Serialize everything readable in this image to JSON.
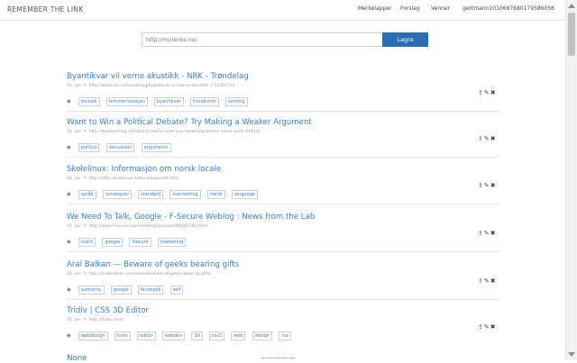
{
  "brand": "REMEMBER THE LINK",
  "nav": [
    "Merkelapper",
    "Forslag",
    "Venner",
    "gertmann1010697680179586056"
  ],
  "form": {
    "placeholder": "http://my.lenke.no/",
    "save_label": "Lagre"
  },
  "links": [
    {
      "title": "Byantikvar vil verne akustikk - NRK - Trøndelag",
      "date": "16. jan",
      "url": "http://www.nrk.no/trondelag/byantikvar-vil-verne-akustikk-1.11203733",
      "tags": [
        "musikk",
        "femmeriveskjen",
        "byantikvar",
        "trondheim",
        "verning"
      ]
    },
    {
      "title": "Want to Win a Political Debate? Try Making a Weaker Argument",
      "date": "16. jan",
      "url": "http://www.psmag.com/politics/why-even-your-best-arguments-never-work-64910/",
      "tags": [
        "politics",
        "discussion",
        "arguments"
      ]
    },
    {
      "title": "Skolelinux: Informasjon om norsk locale",
      "date": "16. jan",
      "url": "http://i18n.skolelinux.no/localeoppsett.html",
      "tags": [
        "språk",
        "norwegian",
        "standard",
        "oversetting",
        "norsk",
        "language"
      ]
    },
    {
      "title": "We Need To Talk, Google - F-Secure Weblog : News from the Lab",
      "date": "16. jan",
      "url": "http://www.f-secure.com/weblog/archives/00002593.html",
      "tags": [
        "users",
        "google",
        "fsecure",
        "marketing"
      ]
    },
    {
      "title": "Aral Balkan — Beware of geeks bearing gifts",
      "date": "16. jan",
      "url": "http://aralbalkan.com/notes/beware-of-geeks-bearing-gifts/",
      "tags": [
        "authority",
        "google",
        "facebook",
        "self"
      ]
    },
    {
      "title": "Tridiv | CSS 3D Editor",
      "date": "16. jan",
      "url": "http://tridiv.com/",
      "tags": [
        "webdesign",
        "tools",
        "editor",
        "webdev",
        "3d",
        "css3",
        "web",
        "design",
        "css"
      ]
    }
  ],
  "partial_title": "None"
}
